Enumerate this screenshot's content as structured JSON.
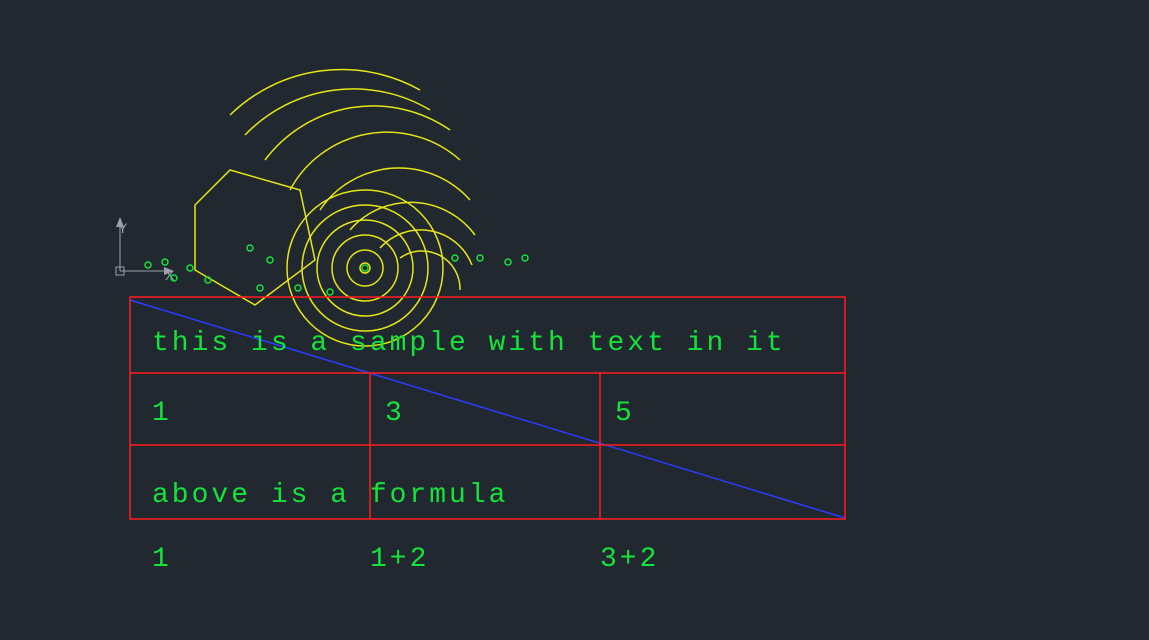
{
  "ucs": {
    "x_label": "X",
    "y_label": "Y"
  },
  "colors": {
    "background": "#212830",
    "text": "#15e33b",
    "table_border": "#ff1e1e",
    "line": "#2a3cff",
    "arcs": "#e6e616",
    "circles": "#e6e616",
    "points": "#15e33b",
    "axis": "#9aa0a8"
  },
  "drawing": {
    "pentagon_vertices_approx": "hexagon-like polygon near origin",
    "concentric_circles_count": 6,
    "arcs_count_approx": 8,
    "points_count_approx": 15
  },
  "table": {
    "row1_merged": "this is a sample with text in it",
    "row2": {
      "c1": "1",
      "c2": "3",
      "c3": "5"
    },
    "row3_merged": "above is a formula"
  },
  "formulas_row": {
    "c1": "1",
    "c2": "1+2",
    "c3": "3+2"
  }
}
